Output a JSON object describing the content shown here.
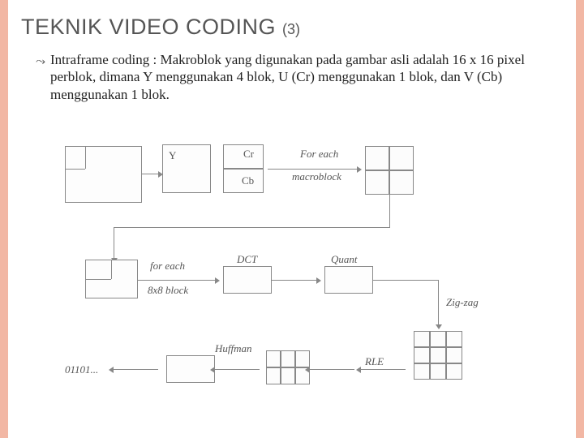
{
  "title": "TEKNIK VIDEO CODING",
  "title_sub": "(3)",
  "bullet_glyph": "ؔ",
  "bullet_text": "Intraframe coding : Makroblok yang digunakan pada gambar asli adalah 16 x 16 pixel perblok, dimana Y menggunakan 4 blok, U (Cr) menggunakan 1 blok, dan V (Cb) menggunakan 1 blok.",
  "diagram": {
    "y_label": "Y",
    "cr_label": "Cr",
    "cb_label": "Cb",
    "for_each_top": "For each",
    "macroblock": "macroblock",
    "for_each_mid": "for each",
    "block_8x8": "8x8 block",
    "dct": "DCT",
    "quant": "Quant",
    "zigzag": "Zig-zag",
    "rle": "RLE",
    "huffman": "Huffman",
    "bits": "01101..."
  }
}
